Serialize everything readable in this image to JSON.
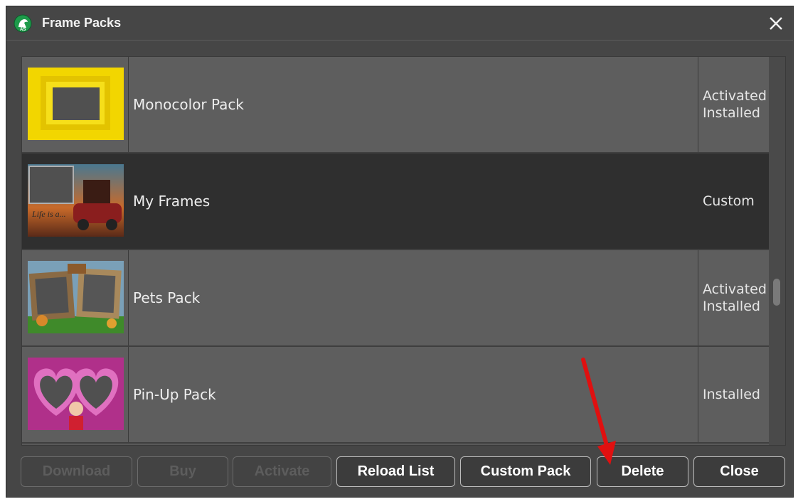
{
  "window": {
    "title": "Frame Packs",
    "logo_text": "AS",
    "close_icon": "close-icon"
  },
  "packs": [
    {
      "name": "Monocolor Pack",
      "status_lines": [
        "Activated",
        "Installed"
      ],
      "selected": false,
      "thumb": "yellow-frame"
    },
    {
      "name": "My Frames",
      "status_lines": [
        "Custom"
      ],
      "selected": true,
      "thumb": "car-photo-frame"
    },
    {
      "name": "Pets Pack",
      "status_lines": [
        "Activated",
        "Installed"
      ],
      "selected": false,
      "thumb": "pets-frame"
    },
    {
      "name": "Pin-Up Pack",
      "status_lines": [
        "Installed"
      ],
      "selected": false,
      "thumb": "hearts-frame"
    }
  ],
  "buttons": {
    "download": "Download",
    "buy": "Buy",
    "activate": "Activate",
    "reload": "Reload List",
    "custom": "Custom Pack",
    "delete": "Delete",
    "close": "Close"
  },
  "colors": {
    "window_bg": "#464646",
    "selected_row": "#2f2f2f",
    "annotation_arrow": "#e01010"
  }
}
